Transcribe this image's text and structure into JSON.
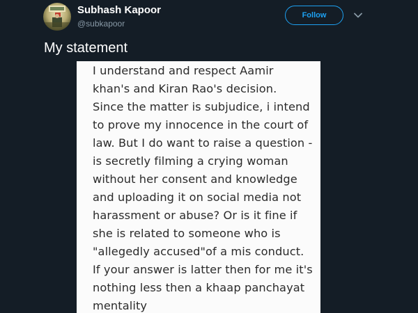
{
  "user": {
    "display_name": "Subhash Kapoor",
    "handle": "@subkapoor",
    "avatar_icon": "profile-photo-icon"
  },
  "actions": {
    "follow_label": "Follow",
    "more_icon": "chevron-down-icon"
  },
  "tweet": {
    "text": "My statement"
  },
  "statement": {
    "lines": [
      "I understand and respect Aamir",
      "khan's and Kiran Rao's decision.",
      "Since the matter is subjudice, i intend",
      "to prove my innocence in the court of",
      "law. But I do want to raise a question -",
      "is secretly filming a crying woman",
      "without her consent and knowledge",
      "and uploading it on social media not",
      "harassment or abuse? Or is it fine if",
      "she is related to someone who is",
      "\"allegedly accused\"of a mis conduct.",
      "If your answer is latter then for me it's",
      "nothing less then a khaap panchayat",
      "mentality"
    ]
  },
  "colors": {
    "background": "#141d26",
    "accent": "#1da1f2",
    "secondary_text": "#8899a6",
    "note_paper": "#fbfbfb",
    "note_text": "#2b2b2b"
  }
}
